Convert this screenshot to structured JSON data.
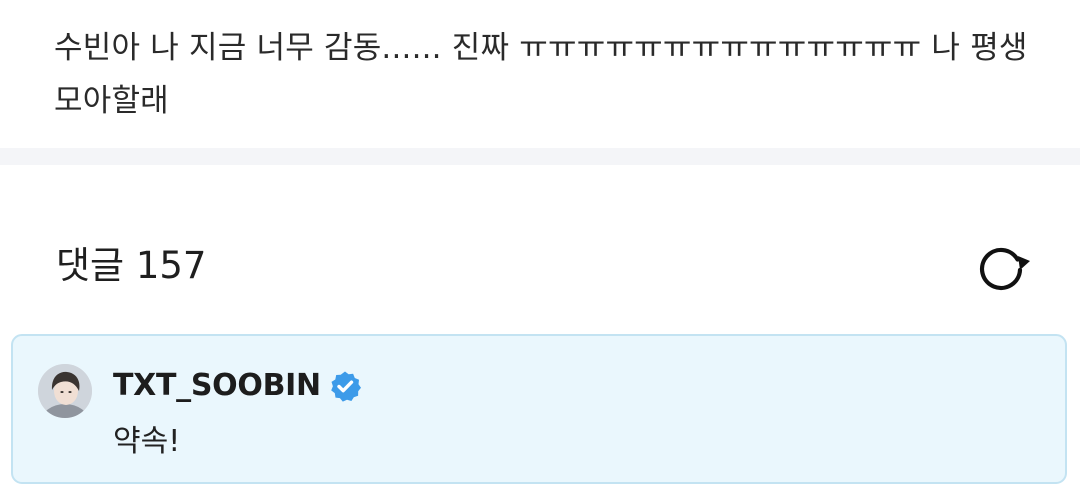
{
  "post": {
    "body": "수빈아 나 지금 너무 감동...... 진짜 ㅠㅠㅠㅠㅠㅠㅠㅠㅠㅠㅠㅠㅠㅠ 나 평생 모아할래"
  },
  "comments": {
    "title": "댓글 157",
    "refresh_icon": "refresh-icon",
    "items": [
      {
        "author": "TXT_SOOBIN",
        "verified": true,
        "verified_icon": "verified-badge-icon",
        "text": "약속!"
      }
    ]
  },
  "colors": {
    "divider": "#f4f5f8",
    "highlight_background": "#eaf7fd",
    "highlight_border": "#c3e3f2",
    "verified_badge": "#3d9be9"
  }
}
